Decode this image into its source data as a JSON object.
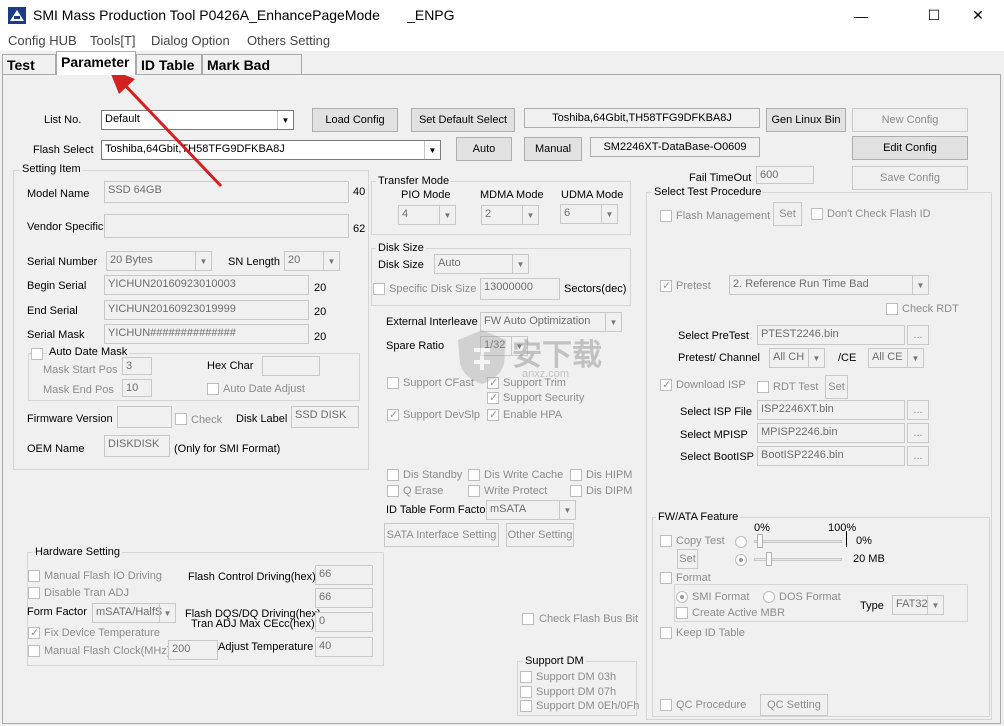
{
  "window": {
    "title": "SMI Mass Production Tool P0426A_EnhancePageMode       _ENPG",
    "minimize": "—",
    "maximize": "☐",
    "close": "✕"
  },
  "menu": [
    "Config HUB",
    "Tools[T]",
    "Dialog Option",
    "Others Setting"
  ],
  "tabs": [
    "Test",
    "Parameter",
    "ID Table",
    "Mark Bad Info"
  ],
  "top": {
    "list_no_label": "List No.",
    "list_no_value": "Default",
    "flash_select_label": "Flash Select",
    "flash_select_value": "Toshiba,64Gbit,TH58TFG9DFKBA8J",
    "load_config": "Load Config",
    "set_default_select": "Set Default Select",
    "flash_info": "Toshiba,64Gbit,TH58TFG9DFKBA8J",
    "gen_linux_bin": "Gen Linux Bin",
    "new_config": "New Config",
    "auto": "Auto",
    "manual": "Manual",
    "database": "SM2246XT-DataBase-O0609",
    "edit_config": "Edit Config",
    "fail_timeout_label": "Fail TimeOut",
    "fail_timeout_value": "600",
    "save_config": "Save Config"
  },
  "setting_item": {
    "title": "Setting Item",
    "model_name_label": "Model Name",
    "model_name_value": "SSD 64GB",
    "model_name_len": "40",
    "vendor_specific_label": "Vendor Specific",
    "vendor_specific_len": "62",
    "serial_number_label": "Serial Number",
    "serial_number_value": "20 Bytes",
    "sn_length_label": "SN Length",
    "sn_length_value": "20",
    "begin_serial_label": "Begin Serial",
    "begin_serial_value": "YICHUN20160923010003",
    "begin_serial_len": "20",
    "end_serial_label": "End Serial",
    "end_serial_value": "YICHUN20160923019999",
    "end_serial_len": "20",
    "serial_mask_label": "Serial Mask",
    "serial_mask_value": "YICHUN##############",
    "serial_mask_len": "20",
    "auto_date_mask": "Auto Date Mask",
    "mask_start_pos_label": "Mask Start Pos",
    "mask_start_pos_value": "3",
    "mask_end_pos_label": "Mask End Pos",
    "mask_end_pos_value": "10",
    "hex_char_label": "Hex Char",
    "auto_date_adjust": "Auto Date Adjust",
    "firmware_version_label": "Firmware Version",
    "check_label": "Check",
    "disk_label_label": "Disk Label",
    "disk_label_value": "SSD DISK",
    "oem_name_label": "OEM Name",
    "oem_name_value": "DISKDISK",
    "oem_note": "(Only for SMI Format)"
  },
  "transfer_mode": {
    "title": "Transfer Mode",
    "pio_label": "PIO Mode",
    "pio_value": "4",
    "mdma_label": "MDMA Mode",
    "mdma_value": "2",
    "udma_label": "UDMA Mode",
    "udma_value": "6"
  },
  "disk_size": {
    "title": "Disk Size",
    "disk_size_label": "Disk Size",
    "disk_size_value": "Auto",
    "specific_label": "Specific Disk Size",
    "specific_value": "13000000",
    "sectors_label": "Sectors(dec)"
  },
  "middle": {
    "external_interleave_label": "External Interleave",
    "external_interleave_value": "FW Auto Optimization",
    "spare_ratio_label": "Spare Ratio",
    "spare_ratio_value": "1/32",
    "support_cfast": "Support CFast",
    "support_trim": "Support Trim",
    "support_security": "Support Security",
    "support_devslp": "Support DevSlp",
    "enable_hpa": "Enable HPA",
    "dis_standby": "Dis Standby",
    "dis_write_cache": "Dis Write Cache",
    "dis_hipm": "Dis HIPM",
    "q_erase": "Q Erase",
    "write_protect": "Write Protect",
    "dis_dipm": "Dis DIPM",
    "id_table_form_factor_label": "ID Table Form Factor",
    "id_table_form_factor_value": "mSATA",
    "sata_interface_setting": "SATA Interface Setting",
    "other_setting": "Other Setting",
    "check_flash_bus_bit": "Check Flash Bus Bit"
  },
  "hardware": {
    "title": "Hardware Setting",
    "manual_flash_io_driving": "Manual Flash IO Driving",
    "flash_control_driving_label": "Flash Control Driving(hex)",
    "flash_control_driving_value": "66",
    "disable_tran_adj": "Disable Tran ADJ",
    "flash_dqs_value": "66",
    "form_factor_label": "Form Factor",
    "form_factor_value": "mSATA/HalfS",
    "flash_dqs_label": "Flash DQS/DQ Driving(hex)",
    "fix_device_temperature": "Fix Device Temperature",
    "tran_adj_label": "Tran ADJ Max CEcc(hex)",
    "tran_adj_value": "0",
    "manual_flash_clock": "Manual Flash Clock(MHz)",
    "flash_clock_value": "200",
    "adjust_temperature_label": "Adjust Temperature",
    "adjust_temperature_value": "40"
  },
  "support_dm": {
    "title": "Support DM",
    "dm03": "Support DM 03h",
    "dm07": "Support DM 07h",
    "dm0e": "Support DM 0Eh/0Fh"
  },
  "test_procedure": {
    "title": "Select Test Procedure",
    "flash_management": "Flash Management",
    "set": "Set",
    "dont_check_flash_id": "Don't Check Flash ID",
    "pretest": "Pretest",
    "pretest_value": "2. Reference Run Time Bad",
    "check_rdt": "Check RDT",
    "select_pretest_label": "Select PreTest",
    "select_pretest_value": "PTEST2246.bin",
    "browse": "...",
    "pretest_channel_label": "Pretest/ Channel",
    "channel_value": "All CH",
    "ce_label": "/CE",
    "ce_value": "All CE",
    "download_isp": "Download ISP",
    "rdt_test": "RDT Test",
    "select_isp_label": "Select ISP File",
    "select_isp_value": "ISP2246XT.bin",
    "select_mpisp_label": "Select MPISP",
    "select_mpisp_value": "MPISP2246.bin",
    "select_bootisp_label": "Select BootISP",
    "select_bootisp_value": "BootISP2246.bin"
  },
  "fw_ata": {
    "title": "FW/ATA Feature",
    "pct0": "0%",
    "pct100": "100%",
    "copy_test": "Copy Test",
    "copy_pct": "0%",
    "set": "Set",
    "mb_value": "20 MB",
    "format": "Format",
    "smi_format": "SMI Format",
    "dos_format": "DOS Format",
    "create_active_mbr": "Create Active MBR",
    "type_label": "Type",
    "type_value": "FAT32",
    "keep_id_table": "Keep ID Table",
    "qc_procedure": "QC Procedure",
    "qc_setting": "QC Setting"
  },
  "watermark": {
    "text": "安下载",
    "sub": "anxz.com"
  },
  "colors": {
    "arrow": "#d42020",
    "title_bar": "#ffffff",
    "panel_bg": "#f0f0f0"
  }
}
